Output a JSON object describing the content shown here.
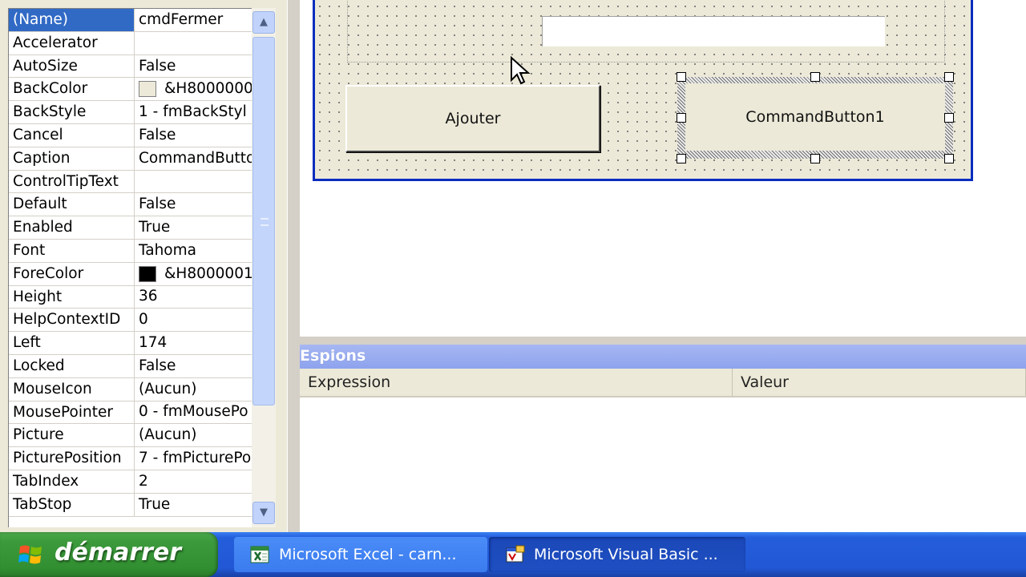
{
  "properties": {
    "rows": [
      {
        "name": "(Name)",
        "value": "cmdFermer",
        "selected": true
      },
      {
        "name": "Accelerator",
        "value": ""
      },
      {
        "name": "AutoSize",
        "value": "False"
      },
      {
        "name": "BackColor",
        "value": "&H8000000",
        "swatch": "#ece9d8"
      },
      {
        "name": "BackStyle",
        "value": "1 - fmBackStyl"
      },
      {
        "name": "Cancel",
        "value": "False"
      },
      {
        "name": "Caption",
        "value": "CommandButto"
      },
      {
        "name": "ControlTipText",
        "value": ""
      },
      {
        "name": "Default",
        "value": "False"
      },
      {
        "name": "Enabled",
        "value": "True"
      },
      {
        "name": "Font",
        "value": "Tahoma"
      },
      {
        "name": "ForeColor",
        "value": "&H8000001",
        "swatch": "#000000"
      },
      {
        "name": "Height",
        "value": "36"
      },
      {
        "name": "HelpContextID",
        "value": "0"
      },
      {
        "name": "Left",
        "value": "174"
      },
      {
        "name": "Locked",
        "value": "False"
      },
      {
        "name": "MouseIcon",
        "value": "(Aucun)"
      },
      {
        "name": "MousePointer",
        "value": "0 - fmMousePo"
      },
      {
        "name": "Picture",
        "value": "(Aucun)"
      },
      {
        "name": "PicturePosition",
        "value": "7 - fmPicturePo"
      },
      {
        "name": "TabIndex",
        "value": "2"
      },
      {
        "name": "TabStop",
        "value": "True"
      }
    ]
  },
  "designer": {
    "ajouter_label": "Ajouter",
    "command_button_label": "CommandButton1"
  },
  "watch": {
    "title": "Espions",
    "col_expression": "Expression",
    "col_value": "Valeur"
  },
  "taskbar": {
    "start_label": "démarrer",
    "tasks": [
      {
        "label": "Microsoft Excel - carn...",
        "icon": "excel-icon"
      },
      {
        "label": "Microsoft Visual Basic ...",
        "icon": "vba-icon",
        "active": true
      }
    ]
  },
  "colors": {
    "selection": "#316ac5",
    "form_border": "#0a2dbf",
    "taskbar": "#245edb",
    "start_button": "#3c9a3c"
  }
}
